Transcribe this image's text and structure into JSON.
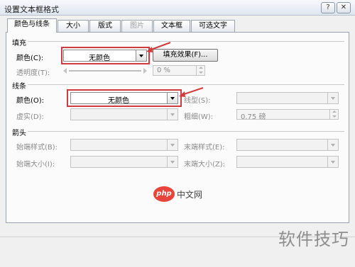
{
  "window": {
    "title": "设置文本框格式",
    "help_label": "?",
    "close_label": "✕"
  },
  "tabs": [
    {
      "label": "颜色与线条",
      "state": "active"
    },
    {
      "label": "大小",
      "state": "normal"
    },
    {
      "label": "版式",
      "state": "normal"
    },
    {
      "label": "图片",
      "state": "disabled"
    },
    {
      "label": "文本框",
      "state": "normal"
    },
    {
      "label": "可选文字",
      "state": "normal"
    }
  ],
  "fill": {
    "heading": "填充",
    "color_label": "颜色(C):",
    "color_value": "无颜色",
    "effects_button": "填充效果(F)...",
    "transparency_label": "透明度(T):",
    "transparency_value": "0 %"
  },
  "line": {
    "heading": "线条",
    "color_label": "颜色(O):",
    "color_value": "无颜色",
    "style_label": "线型(S):",
    "dashed_label": "虚实(D):",
    "weight_label": "粗细(W):",
    "weight_value": "0.75 磅"
  },
  "arrows": {
    "heading": "箭头",
    "begin_style_label": "始端样式(B):",
    "end_style_label": "末端样式(E):",
    "begin_size_label": "始端大小(I):",
    "end_size_label": "末端大小(Z):"
  },
  "watermarks": {
    "php_badge": "php",
    "php_text": "中文网",
    "brand": "软件技巧"
  },
  "colors": {
    "highlight": "#d23b3b",
    "php_red": "#e7443c"
  },
  "icons": {
    "help": "question-icon",
    "close": "close-icon",
    "dropdown": "chevron-down-icon"
  }
}
